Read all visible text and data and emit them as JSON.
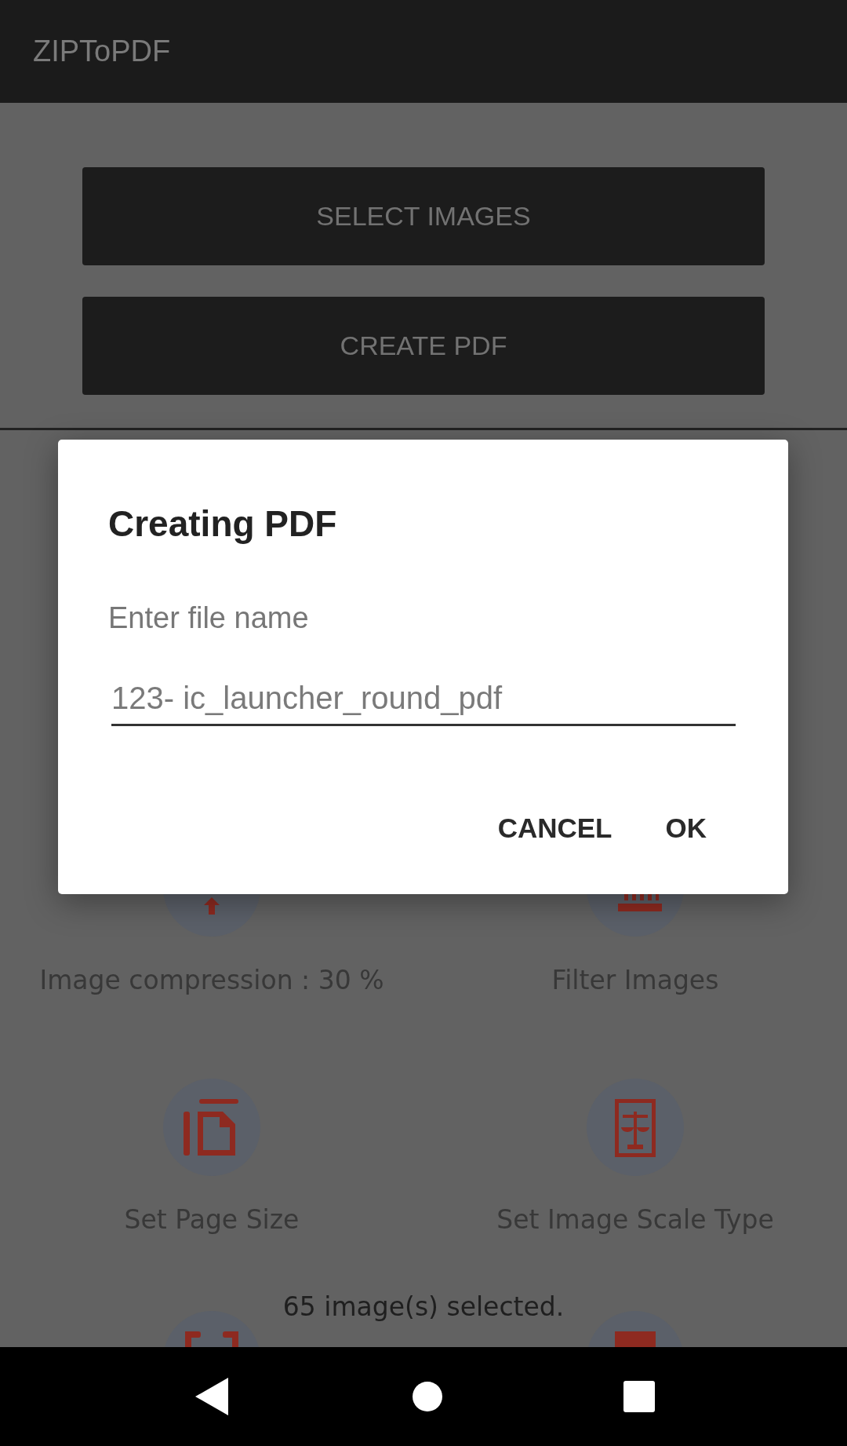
{
  "app_bar": {
    "title": "ZIPToPDF"
  },
  "buttons": [
    "SELECT IMAGES",
    "CREATE PDF"
  ],
  "options": [
    {
      "kind": "compress",
      "label": "Image compression : 30 %"
    },
    {
      "kind": "filter",
      "label": "Filter Images"
    },
    {
      "kind": "page_size",
      "label": "Set Page Size"
    },
    {
      "kind": "scale",
      "label": "Set Image Scale Type"
    }
  ],
  "status": "65 image(s) selected.",
  "more_options": [
    {
      "kind": "margins"
    },
    {
      "kind": "document"
    }
  ],
  "dialog": {
    "title": "Creating PDF",
    "label": "Enter file name",
    "value": "123- ic_launcher_round_pdf",
    "actions": [
      "CANCEL",
      "OK"
    ]
  }
}
